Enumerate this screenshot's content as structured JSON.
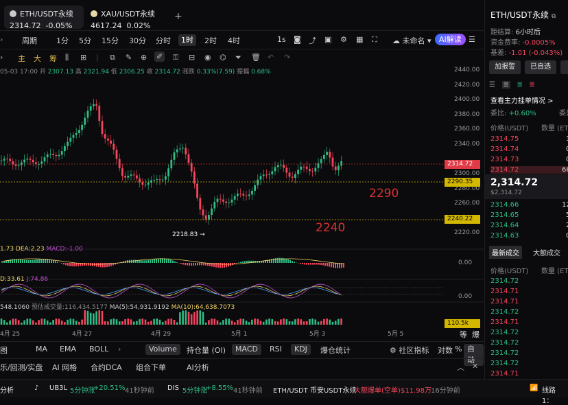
{
  "tabs": [
    {
      "name": "ETH/USDT永续",
      "price": "2314.72",
      "change": "-0.05%"
    },
    {
      "name": "XAU/USDT永续",
      "price": "4617.24",
      "change": "0.02%"
    }
  ],
  "add_tab": "+",
  "timeframes": {
    "period": "周期",
    "items": [
      "1分",
      "5分",
      "15分",
      "30分",
      "分时",
      "1时",
      "2时",
      "4时"
    ],
    "selected": "1时",
    "zoom": "1s",
    "unnamed": "未命名",
    "ai": "AI解读"
  },
  "tool_labels": [
    "主",
    "大",
    "筹"
  ],
  "ohlc": {
    "time": "05-03 17:00",
    "open_l": "开",
    "open": "2307.13",
    "high_l": "高",
    "high": "2321.94",
    "low_l": "低",
    "low": "2306.25",
    "close_l": "收",
    "close": "2314.72",
    "chg_l": "涨跌",
    "chg": "0.33%(7.59)",
    "amp_l": "振幅",
    "amp": "0.68%"
  },
  "y_ticks": [
    "2440.00",
    "2420.00",
    "2400.00",
    "2380.00",
    "2360.00",
    "2340.00",
    "2300.00",
    "2280.00",
    "2260.00",
    "2220.00"
  ],
  "price_tags": {
    "current": "2314.72",
    "line_2290": "2290.35",
    "line_2240": "2240.22",
    "vol": "110.5k"
  },
  "annotations": {
    "a2290": "2290",
    "a2240": "2240",
    "low": "2218.83 →"
  },
  "macd": {
    "dif": "1.73",
    "dea": "DEA:2.23",
    "macd": "MACD:-1.00",
    "zero": "0.00"
  },
  "kdj": {
    "j": "J:74.86",
    "d": "D:33.61",
    "zero": "0.00"
  },
  "volume": {
    "vol": "548.1060",
    "pred": "预估成交量:116,434.5177",
    "ma5": "MA(5):54,931.9192",
    "ma10": "MA(10):64,638.7073"
  },
  "x_ticks": [
    "4月 25",
    "4月 27",
    "4月 29",
    "5月 1",
    "5月 3",
    "5月 5"
  ],
  "x_right": [
    "等",
    "爆"
  ],
  "indicators": {
    "items": [
      "MA",
      "EMA",
      "BOLL",
      "Volume",
      "持仓量 (OI)",
      "MACD",
      "RSI",
      "KDJ",
      "爆仓统计"
    ],
    "prefix": "图",
    "settings": "社区指标",
    "log": "对数",
    "pct": "%",
    "auto": "自动"
  },
  "bottom_tabs": [
    "乐/回测/实盘",
    "AI 网格",
    "合约DCA",
    "组合下单",
    "AI分析"
  ],
  "ticker": {
    "label": "分析",
    "items": [
      {
        "sym": "UB3L",
        "desc": "5分钟涨",
        "val": "+20.51%",
        "ago": "41秒钟前"
      },
      {
        "sym": "DIS",
        "desc": "5分钟涨",
        "val": "+8.55%",
        "ago": "41秒钟前"
      },
      {
        "sym": "ETH/USDT 币安USDT永续",
        "desc": "大额爆单(空单)",
        "val": "$11.98万",
        "ago": "16分钟前"
      }
    ],
    "line": "线路 1："
  },
  "right": {
    "title": "ETH/USDT永续",
    "settle_l": "距结算",
    "settle": "6小时后",
    "fund_l": "资金费率",
    "fund": "-0.0005%",
    "basis_l": "基差",
    "basis": "-1.01 (-0.043%)",
    "alert": "加报警",
    "selected": "已自选",
    "depth_title": "查看主力挂单情况 >",
    "ratio_l": "委比",
    "ratio": "+0.60%",
    "ratio2": "委差",
    "col_price": "价格(USDT)",
    "col_qty": "数量 (ETH",
    "asks": [
      {
        "p": "2314.75",
        "q": "1"
      },
      {
        "p": "2314.74",
        "q": "0"
      },
      {
        "p": "2314.73",
        "q": "0"
      },
      {
        "p": "2314.72",
        "q": "66"
      }
    ],
    "last": "2,314.72",
    "last_sub": "$2,314.72",
    "bids": [
      {
        "p": "2314.66",
        "q": "12"
      },
      {
        "p": "2314.65",
        "q": "5"
      },
      {
        "p": "2314.64",
        "q": "2"
      },
      {
        "p": "2314.63",
        "q": "0"
      }
    ],
    "trades_tab": "最新成交",
    "big_tab": "大额成交",
    "trades": [
      {
        "p": "2314.72",
        "c": "g"
      },
      {
        "p": "2314.71",
        "c": "r"
      },
      {
        "p": "2314.71",
        "c": "r"
      },
      {
        "p": "2314.72",
        "c": "g"
      },
      {
        "p": "2314.71",
        "c": "r"
      },
      {
        "p": "2314.72",
        "c": "g"
      },
      {
        "p": "2314.72",
        "c": "g"
      },
      {
        "p": "2314.72",
        "c": "g"
      },
      {
        "p": "2314.72",
        "c": "g"
      },
      {
        "p": "2314.71",
        "c": "r"
      }
    ]
  },
  "colors": {
    "up": "#2ebd85",
    "down": "#f6465d",
    "accent": "#4d7cfe"
  }
}
